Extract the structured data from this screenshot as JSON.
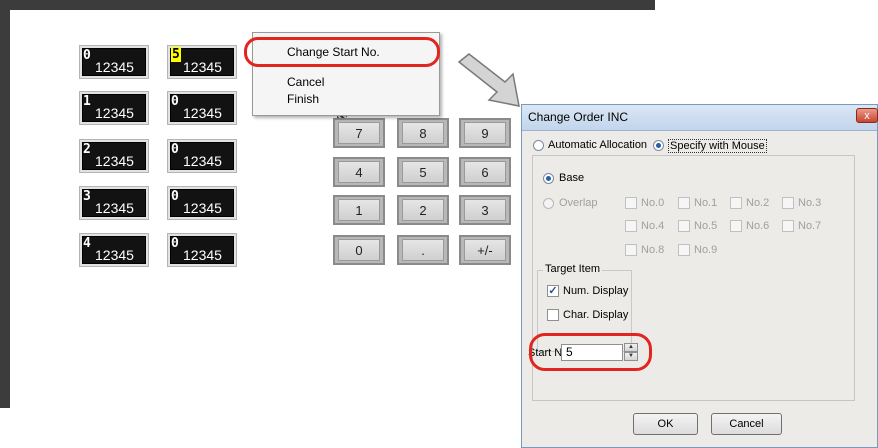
{
  "editor": {
    "num_displays": [
      {
        "index": "0",
        "value": "12345"
      },
      {
        "index": "5",
        "value": "12345",
        "highlighted": true
      },
      {
        "index": "1",
        "value": "12345"
      },
      {
        "index": "0",
        "value": "12345"
      },
      {
        "index": "2",
        "value": "12345"
      },
      {
        "index": "0",
        "value": "12345"
      },
      {
        "index": "3",
        "value": "12345"
      },
      {
        "index": "0",
        "value": "12345"
      },
      {
        "index": "4",
        "value": "12345"
      },
      {
        "index": "0",
        "value": "12345"
      }
    ],
    "keypad": [
      "7",
      "8",
      "9",
      "4",
      "5",
      "6",
      "1",
      "2",
      "3",
      "0",
      ".",
      "+/-"
    ]
  },
  "context_menu": {
    "items": [
      "Change Start No.",
      "Cancel",
      "Finish"
    ]
  },
  "dialog": {
    "title": "Change Order INC",
    "close_label": "x",
    "mode_automatic": "Automatic Allocation",
    "mode_mouse": "Specify with Mouse",
    "base_label": "Base",
    "overlap_label": "Overlap",
    "overlap_options": [
      "No.0",
      "No.1",
      "No.2",
      "No.3",
      "No.4",
      "No.5",
      "No.6",
      "No.7",
      "No.8",
      "No.9"
    ],
    "target_item_label": "Target Item",
    "num_display_label": "Num. Display",
    "char_display_label": "Char. Display",
    "start_no_label": "Start No.",
    "start_no_value": "5",
    "ok_label": "OK",
    "cancel_label": "Cancel"
  },
  "colors": {
    "highlight_ring": "#e0261f",
    "index_highlight": "#ffff00",
    "display_background": "#121212"
  }
}
